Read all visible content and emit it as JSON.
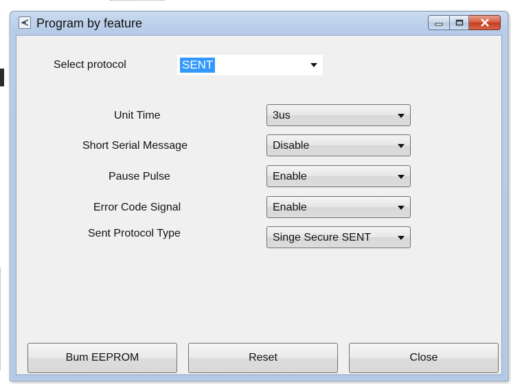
{
  "window": {
    "title": "Program by feature"
  },
  "protocol": {
    "label": "Select protocol",
    "value": "SENT"
  },
  "settings": [
    {
      "label": "Unit Time",
      "value": "3us"
    },
    {
      "label": "Short Serial Message",
      "value": "Disable"
    },
    {
      "label": "Pause Pulse",
      "value": "Enable"
    },
    {
      "label": "Error Code Signal",
      "value": "Enable"
    },
    {
      "label": "Sent Protocol Type",
      "value": "Singe Secure SENT"
    }
  ],
  "buttons": {
    "burn": "Bum EEPROM",
    "reset": "Reset",
    "close": "Close"
  },
  "icons": {
    "app": "app-icon",
    "minimize": "minimize-icon",
    "maximize": "maximize-icon",
    "close": "close-icon",
    "dropdown": "chevron-down-icon"
  },
  "colors": {
    "selection": "#3399ff",
    "close_button": "#c43b1e",
    "title_bar": "#b9cde8",
    "client": "#f0f0f0"
  }
}
